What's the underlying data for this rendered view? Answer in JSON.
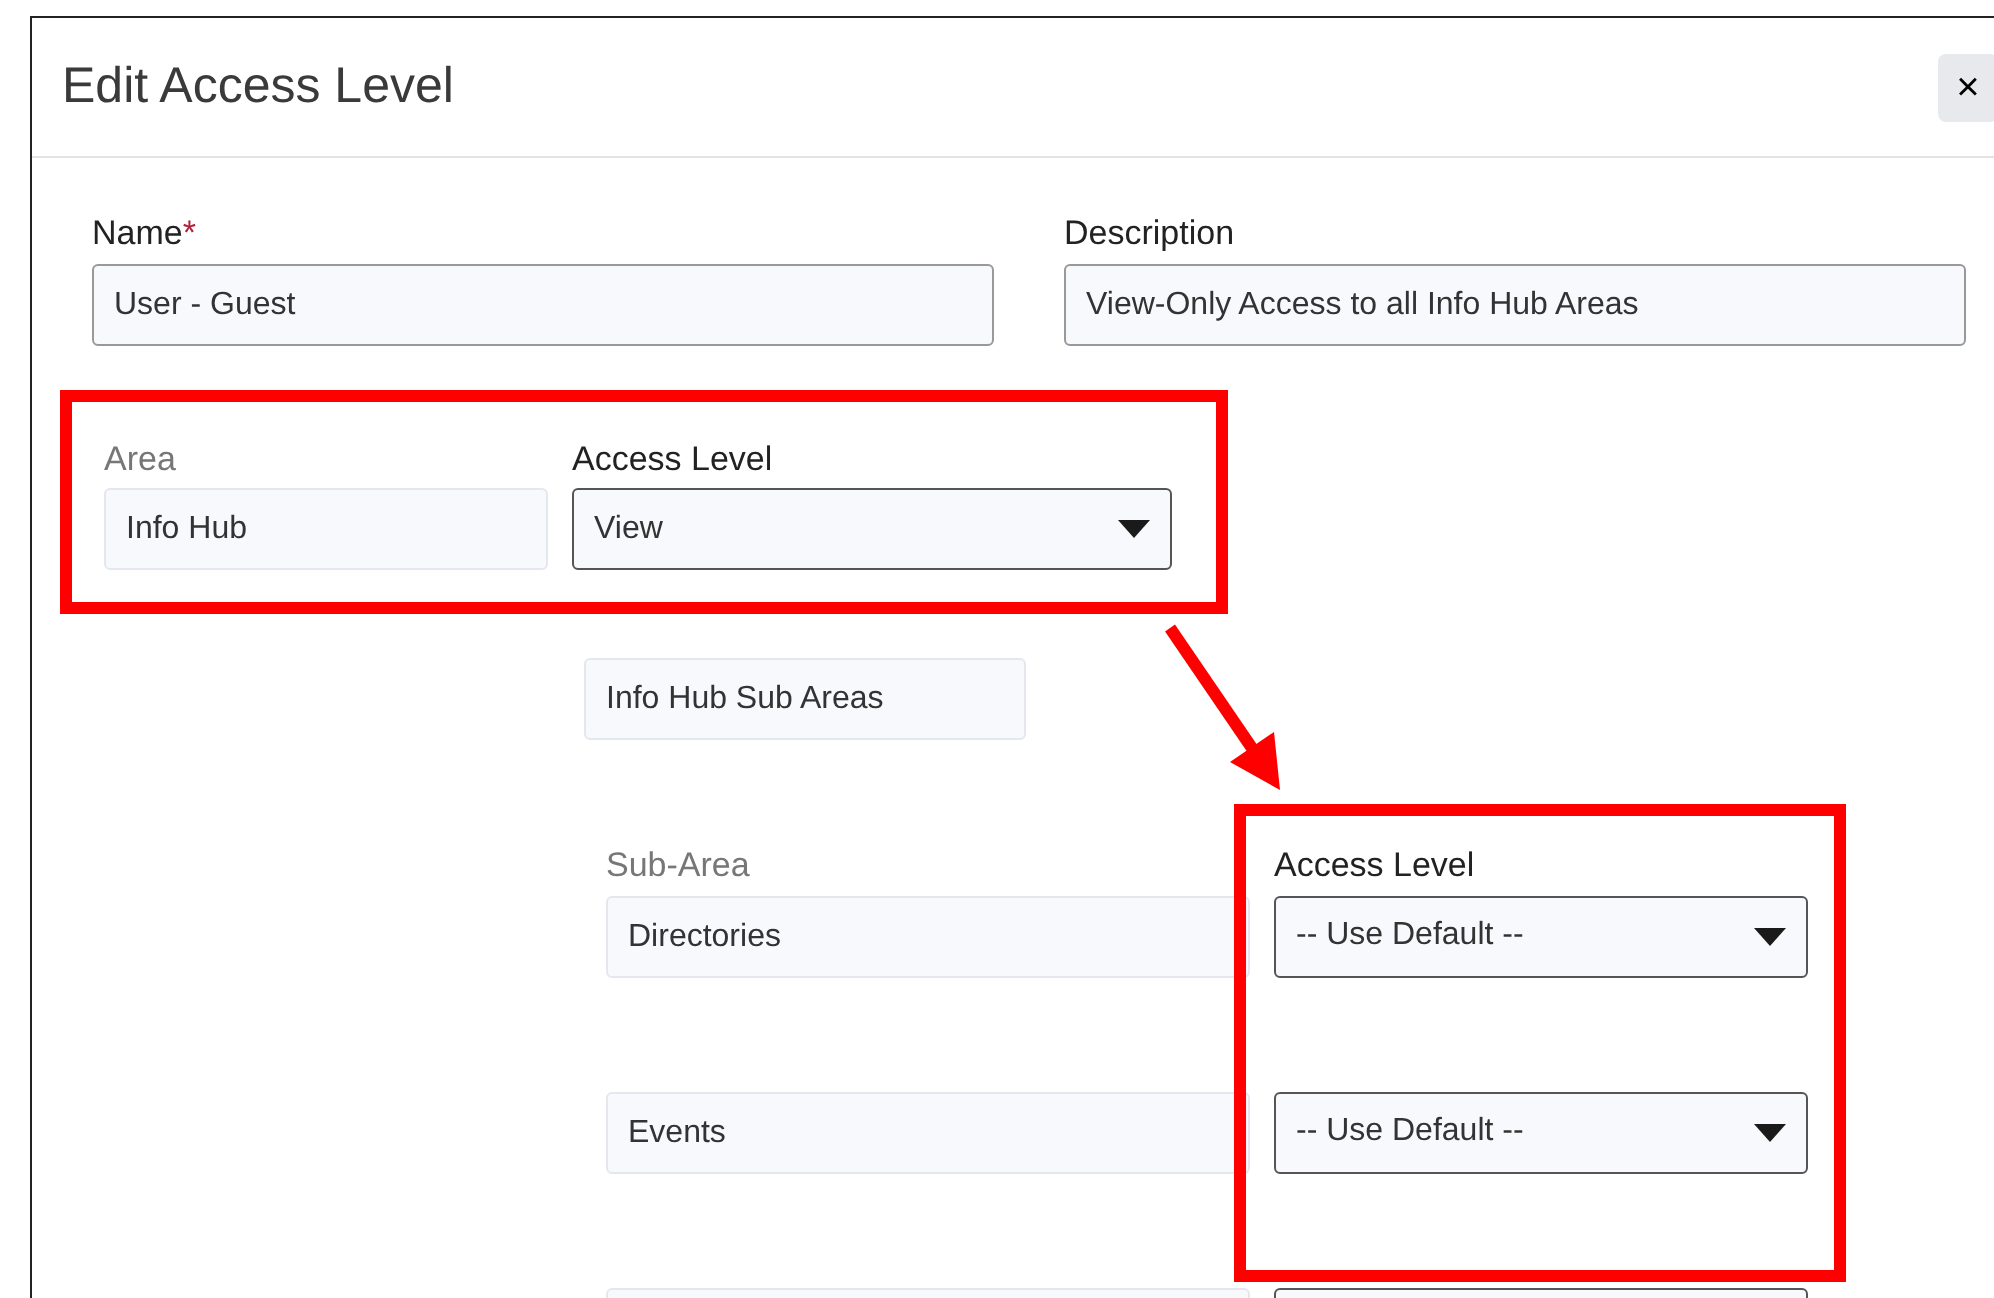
{
  "dialog": {
    "title": "Edit Access Level",
    "close": "×"
  },
  "fields": [
    {
      "label": "Name",
      "required": true,
      "value": "User - Guest"
    },
    {
      "label": "Description",
      "required": false,
      "value": "View-Only Access to all Info Hub Areas"
    }
  ],
  "required_mark": "*",
  "area": {
    "label": "Area",
    "value": "Info Hub",
    "access_label": "Access Level",
    "access_value": "View"
  },
  "sub_area_heading": "Info Hub Sub Areas",
  "sub_areas": {
    "name_label": "Sub-Area",
    "access_label": "Access Level",
    "rows": [
      {
        "name": "Directories",
        "access": "-- Use Default --"
      },
      {
        "name": "Events",
        "access": "-- Use Default --"
      }
    ],
    "clipped_row": true
  },
  "annotations": [
    {
      "kind": "box"
    },
    {
      "kind": "arrow"
    },
    {
      "kind": "box"
    }
  ]
}
